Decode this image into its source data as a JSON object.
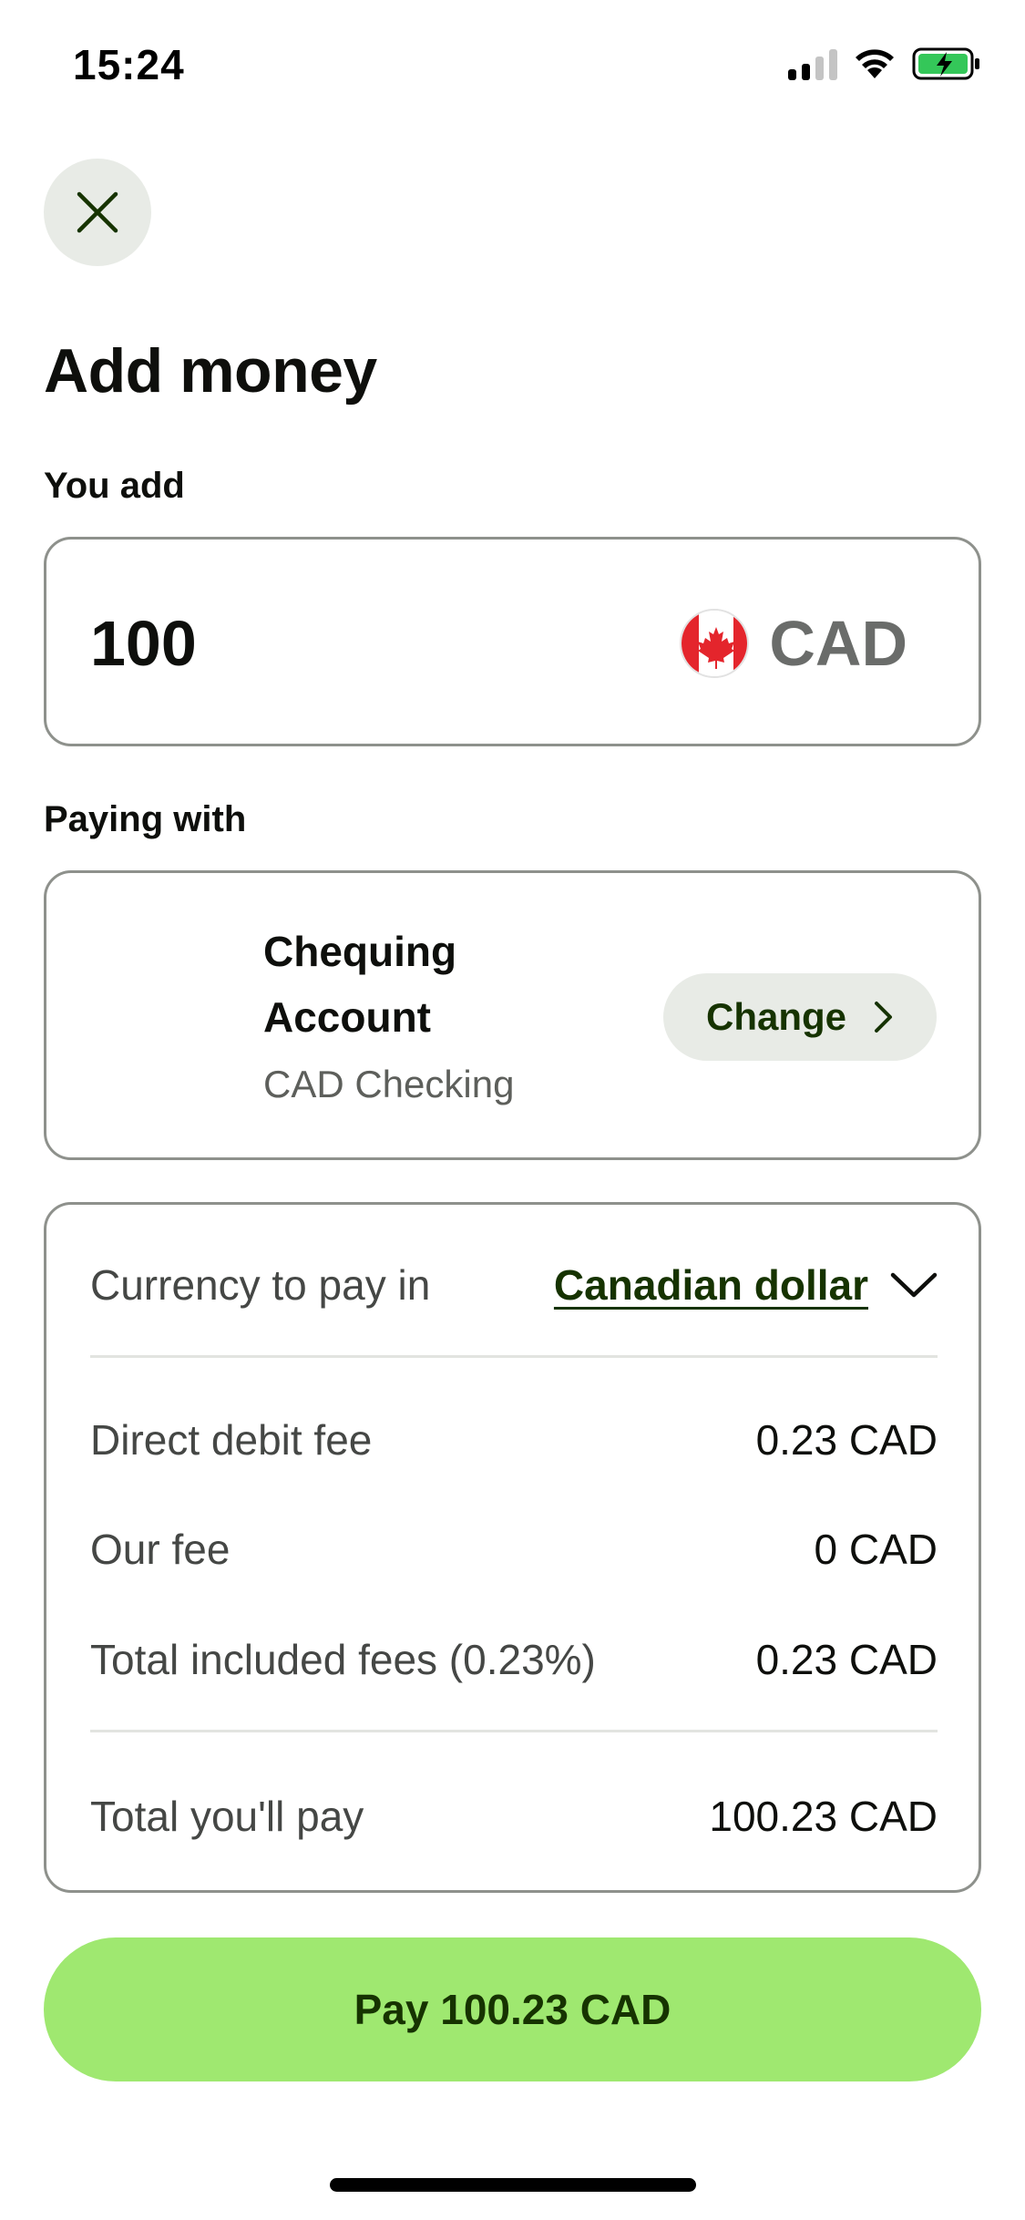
{
  "status_bar": {
    "time": "15:24"
  },
  "header": {
    "close_icon": "close-icon",
    "title": "Add money"
  },
  "amount": {
    "label": "You add",
    "value": "100",
    "currency": "CAD",
    "flag_icon": "canada-flag-icon"
  },
  "paying_with": {
    "label": "Paying with",
    "account_name_line1": "Chequing",
    "account_name_line2": "Account",
    "account_sub": "CAD Checking",
    "change_label": "Change"
  },
  "fees": {
    "currency_label": "Currency to pay in",
    "currency_value": "Canadian dollar",
    "rows": [
      {
        "label": "Direct debit fee",
        "value": "0.23 CAD"
      },
      {
        "label": "Our fee",
        "value": "0 CAD"
      },
      {
        "label": "Total included fees (0.23%)",
        "value": "0.23 CAD"
      }
    ],
    "total_label": "Total you'll pay",
    "total_value": "100.23 CAD"
  },
  "pay_button": {
    "label": "Pay 100.23 CAD"
  },
  "colors": {
    "accent": "#9fe870",
    "brand_dark": "#163300",
    "border": "#8e918c",
    "chip_bg": "#e8ebe6"
  }
}
